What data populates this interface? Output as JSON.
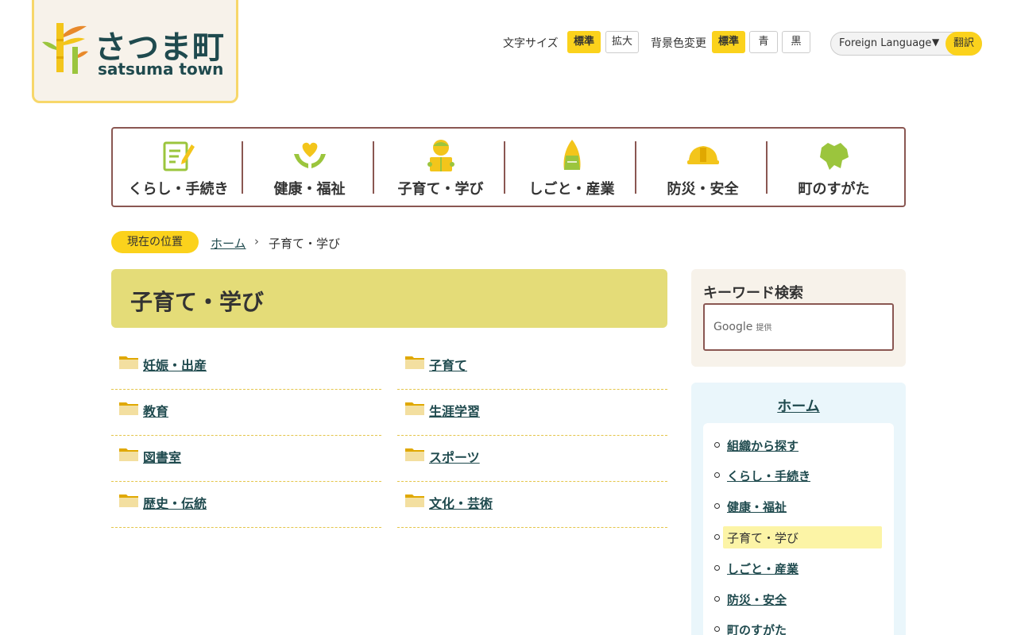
{
  "header": {
    "logo_jp": "さつま町",
    "logo_en": "satsuma town",
    "font_size_label": "文字サイズ",
    "font_size_standard": "標準",
    "font_size_large": "拡大",
    "bg_color_label": "背景色変更",
    "bg_standard": "標準",
    "bg_blue": "青",
    "bg_black": "黒",
    "language_select": "Foreign Language",
    "translate_button": "翻訳"
  },
  "gnav": {
    "items": [
      {
        "label": "くらし・手続き",
        "icon": "form-pen-icon"
      },
      {
        "label": "健康・福祉",
        "icon": "heart-hands-icon"
      },
      {
        "label": "子育て・学び",
        "icon": "child-book-icon"
      },
      {
        "label": "しごと・産業",
        "icon": "bamboo-shoot-icon"
      },
      {
        "label": "防災・安全",
        "icon": "helmet-icon"
      },
      {
        "label": "町のすがた",
        "icon": "town-map-icon"
      }
    ]
  },
  "breadcrumb": {
    "badge": "現在の位置",
    "home": "ホーム",
    "separator": "›",
    "current": "子育て・学び"
  },
  "main": {
    "title": "子育て・学び",
    "categories": [
      "妊娠・出産",
      "子育て",
      "教育",
      "生涯学習",
      "図書室",
      "スポーツ",
      "歴史・伝統",
      "文化・芸術"
    ]
  },
  "sidebar": {
    "keyword_title": "キーワード検索",
    "search_placeholder": "Google",
    "search_provided": "提供",
    "nav_title": "ホーム",
    "nav_items": [
      "組織から探す",
      "くらし・手続き",
      "健康・福祉",
      "子育て・学び",
      "しごと・産業",
      "防災・安全",
      "町のすがた"
    ],
    "current_index": 3
  },
  "colors": {
    "accent_yellow": "#fbd21c",
    "nav_border": "#8a5752",
    "title_band": "#e4dc78",
    "link": "#1f4a4e",
    "sidebar_bg": "#eaf6fb"
  }
}
